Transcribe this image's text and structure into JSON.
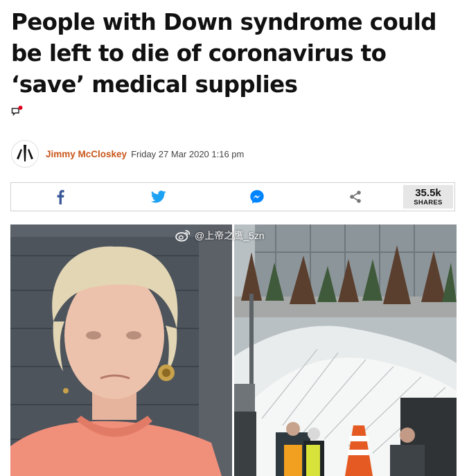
{
  "article": {
    "headline": "People with Down syndrome could be left to die of coronavirus to ‘save’ medical supplies"
  },
  "byline": {
    "author": "Jimmy McCloskey",
    "date": "Friday 27 Mar 2020 1:16 pm"
  },
  "share_bar": {
    "buttons": [
      {
        "name": "facebook",
        "icon": "facebook-icon",
        "color": "#3b5998"
      },
      {
        "name": "twitter",
        "icon": "twitter-icon",
        "color": "#1da1f2"
      },
      {
        "name": "messenger",
        "icon": "messenger-icon",
        "color": "#0084ff"
      },
      {
        "name": "share",
        "icon": "share-icon",
        "color": "#777777"
      }
    ],
    "count": "35.5k",
    "count_label": "SHARES"
  },
  "watermark": {
    "text": "@上帝之鹰_5zn",
    "icon": "weibo-icon"
  },
  "colors": {
    "author": "#c8561a",
    "notification_dot": "#e2001a"
  }
}
